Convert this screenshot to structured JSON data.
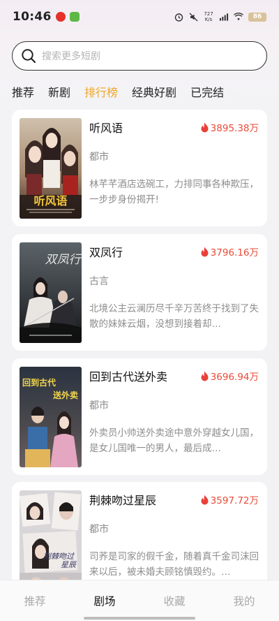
{
  "status_bar": {
    "time": "10:46",
    "signal_text": "727 K/s",
    "battery": "86"
  },
  "search": {
    "placeholder": "搜索更多短剧"
  },
  "tabs": [
    {
      "label": "推荐",
      "active": false
    },
    {
      "label": "新剧",
      "active": false
    },
    {
      "label": "排行榜",
      "active": true
    },
    {
      "label": "经典好剧",
      "active": false
    },
    {
      "label": "已完结",
      "active": false
    }
  ],
  "dramas": [
    {
      "title": "听风语",
      "heat": "3895.38万",
      "genre": "都市",
      "desc": "林芊芊酒店选碗工，力排同事各种欺压，一步步身份揭开!",
      "poster_text": "听风语"
    },
    {
      "title": "双凤行",
      "heat": "3796.16万",
      "genre": "古言",
      "desc": "北境公主云澜历尽千辛万苦终于找到了失散的妹妹云烟，没想到接着却…",
      "poster_text": "双凤行"
    },
    {
      "title": "回到古代送外卖",
      "heat": "3696.94万",
      "genre": "都市",
      "desc": "外卖员小帅送外卖途中意外穿越女儿国，是女儿国唯一的男人，最后成…",
      "poster_text": "回到古代送外卖"
    },
    {
      "title": "荆棘吻过星辰",
      "heat": "3597.72万",
      "genre": "都市",
      "desc": "司荞是司家的假千金，随着真千金司沫回来以后，被未婚夫顾铭慎毁约。…",
      "poster_text": "荆棘吻过星辰"
    }
  ],
  "bottom_nav": [
    {
      "label": "推荐",
      "active": false
    },
    {
      "label": "剧场",
      "active": true
    },
    {
      "label": "收藏",
      "active": false
    },
    {
      "label": "我的",
      "active": false
    }
  ],
  "colors": {
    "accent": "#f0a626",
    "heat": "#ea4a37"
  }
}
